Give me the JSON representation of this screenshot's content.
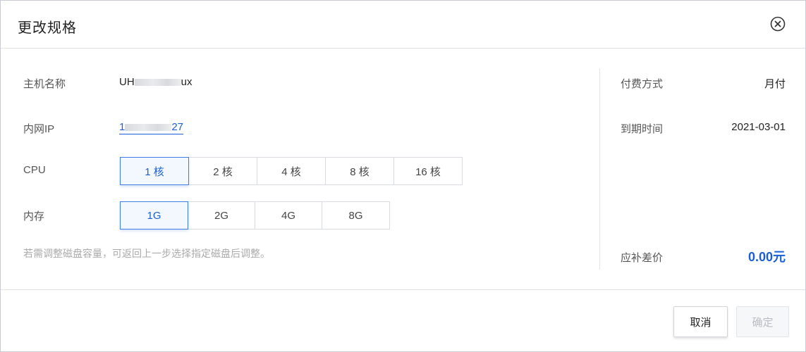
{
  "dialog": {
    "title": "更改规格",
    "close_icon": "close-circle-icon"
  },
  "form": {
    "host_name_label": "主机名称",
    "host_name_prefix": "UH",
    "host_name_suffix": "ux",
    "ip_label": "内网IP",
    "ip_prefix": "1",
    "ip_suffix": "27",
    "cpu_label": "CPU",
    "cpu_options": [
      "1 核",
      "2 核",
      "4 核",
      "8 核",
      "16 核"
    ],
    "cpu_selected": "1 核",
    "memory_label": "内存",
    "memory_options": [
      "1G",
      "2G",
      "4G",
      "8G"
    ],
    "memory_selected": "1G",
    "hint": "若需调整磁盘容量，可返回上一步选择指定磁盘后调整。"
  },
  "summary": {
    "payment_label": "付费方式",
    "payment_value": "月付",
    "expiry_label": "到期时间",
    "expiry_value": "2021-03-01",
    "diff_label": "应补差价",
    "diff_value": "0.00元"
  },
  "footer": {
    "cancel_label": "取消",
    "confirm_label": "确定"
  },
  "colors": {
    "accent": "#1a5fd6",
    "selected_border": "#3d7ee6",
    "disabled_text": "#b8bcc2"
  }
}
